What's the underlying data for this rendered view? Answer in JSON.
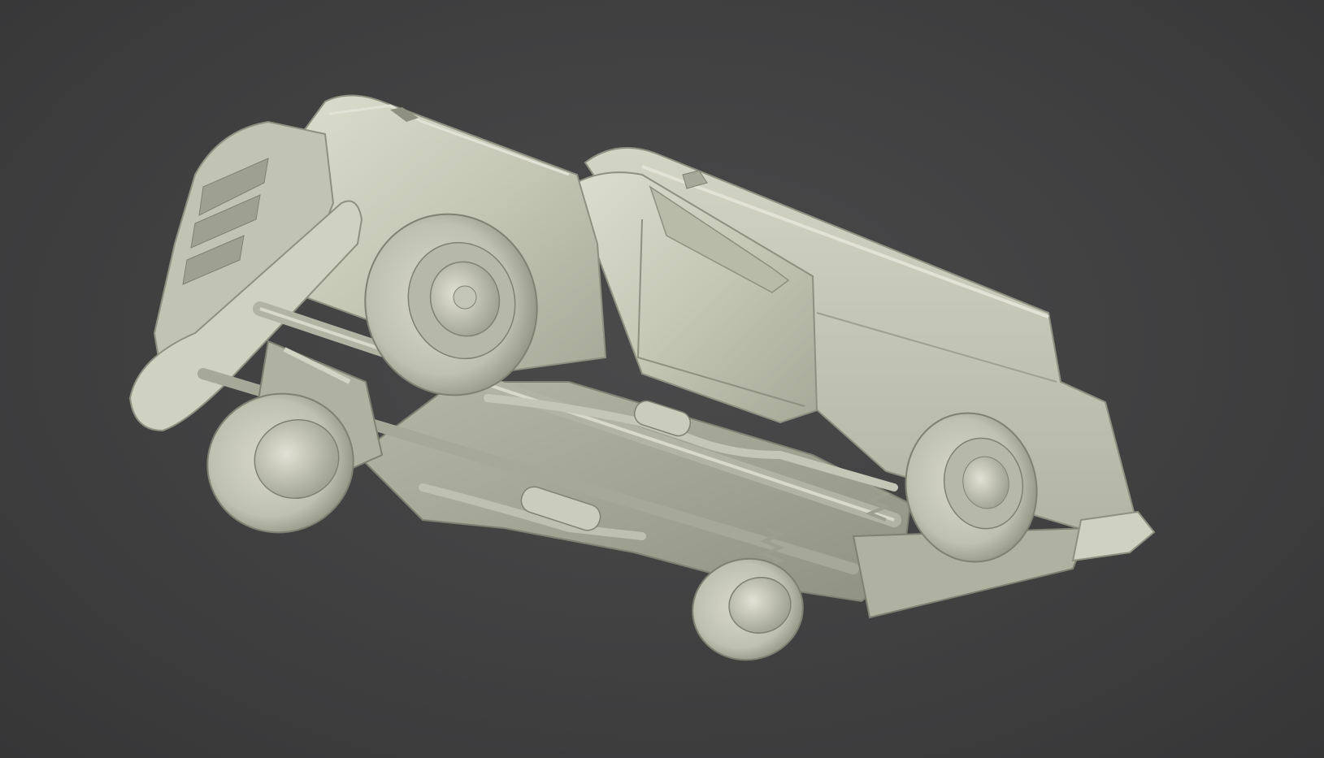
{
  "viewport": {
    "background_color": "#414142",
    "model_color": "#c9cbb9",
    "model_shadow_color": "#8e9080",
    "model_highlight_color": "#e2e3d6",
    "model": "pickup-truck-underside-clay-render"
  }
}
